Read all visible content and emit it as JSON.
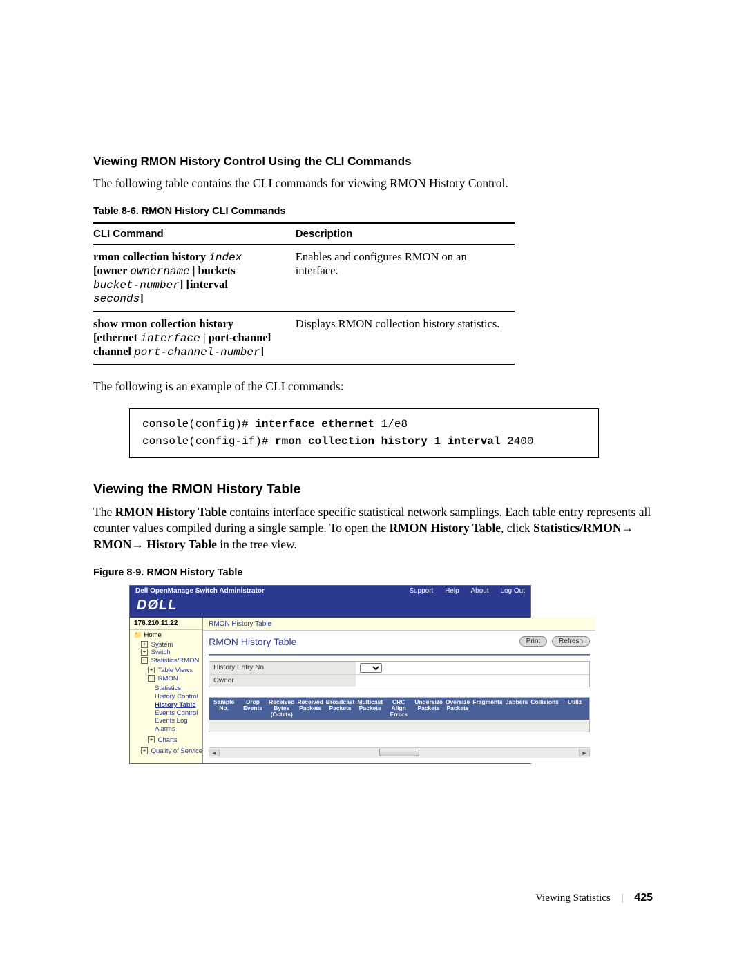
{
  "heading_cli": "Viewing RMON History Control Using the CLI Commands",
  "intro_1": "The following table contains the CLI commands for viewing RMON History Control.",
  "table_caption": "Table 8-6.   RMON History CLI Commands",
  "cli_table": {
    "headers": [
      "CLI Command",
      "Description"
    ],
    "rows": [
      {
        "cmd_parts": {
          "k1": "rmon collection history ",
          "v1": "index",
          "k2": " [owner ",
          "v2": "ownername",
          "k3": " | buckets ",
          "v3": "bucket-number",
          "k4": "] [interval ",
          "v4": "seconds",
          "k5": "]"
        },
        "desc": "Enables and configures RMON on an interface."
      },
      {
        "cmd_parts": {
          "k1": "show rmon collection history",
          "k2": " [ethernet ",
          "v2": "interface",
          "k3": " | port-channel ",
          "v3": "port-channel-number",
          "k4": "]"
        },
        "desc": "Displays RMON collection history statistics."
      }
    ]
  },
  "intro_2": "The following is an example of the CLI commands:",
  "code": {
    "l1a": "console(config)# ",
    "l1b": "interface ethernet",
    "l1c": " 1/e8",
    "l2a": "console(config-if)# ",
    "l2b": "rmon collection history",
    "l2c": " 1 ",
    "l2d": "interval",
    "l2e": " 2400"
  },
  "heading_view": "Viewing the RMON History Table",
  "para_view": {
    "p1": "The ",
    "b1": "RMON History Table",
    "p2": " contains interface specific statistical network samplings. Each table entry represents all counter values compiled during a single sample. To open the ",
    "b2": "RMON History Table",
    "p3": ", click ",
    "b3": "Statistics/RMON→ RMON→ History Table",
    "p4": " in the tree view."
  },
  "figure_caption": "Figure 8-9.   RMON History Table",
  "screenshot": {
    "app_title": "Dell OpenManage Switch Administrator",
    "top_links": [
      "Support",
      "Help",
      "About",
      "Log Out"
    ],
    "logo": "DØLL",
    "ip": "176.210.11.22",
    "breadcrumb": "RMON History Table",
    "tree": {
      "home": "Home",
      "system": "System",
      "switch": "Switch",
      "stats": "Statistics/RMON",
      "tv": "Table Views",
      "rmon": "RMON",
      "rmon_children": [
        "Statistics",
        "History Control",
        "History Table",
        "Events Control",
        "Events Log",
        "Alarms"
      ],
      "charts": "Charts",
      "qos": "Quality of Service"
    },
    "panel_title": "RMON History Table",
    "buttons": [
      "Print",
      "Refresh"
    ],
    "form": {
      "row1_label": "History Entry No.",
      "row2_label": "Owner"
    },
    "table_headers": [
      "Sample No.",
      "Drop Events",
      "Received Bytes (Octets)",
      "Received Packets",
      "Broadcast Packets",
      "Multicast Packets",
      "CRC Align Errors",
      "Undersize Packets",
      "Oversize Packets",
      "Fragments",
      "Jabbers",
      "Collisions",
      "Utiliz"
    ]
  },
  "footer": {
    "chapter": "Viewing Statistics",
    "page": "425"
  }
}
